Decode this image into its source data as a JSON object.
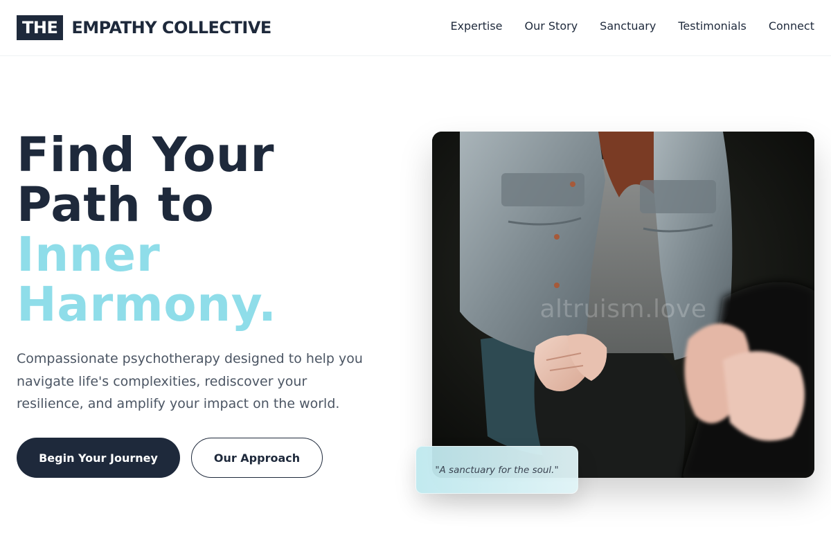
{
  "header": {
    "logo_mark": "THE",
    "logo_text": "EMPATHY COLLECTIVE",
    "nav": [
      {
        "label": "Expertise"
      },
      {
        "label": "Our Story"
      },
      {
        "label": "Sanctuary"
      },
      {
        "label": "Testimonials"
      },
      {
        "label": "Connect"
      }
    ]
  },
  "hero": {
    "title_line1": "Find Your",
    "title_line2": "Path to",
    "title_accent1": "Inner",
    "title_accent2": "Harmony.",
    "description": "Compassionate psychotherapy designed to help you navigate life's complexities, rediscover your resilience, and amplify your impact on the world.",
    "primary_button": "Begin Your Journey",
    "secondary_button": "Our Approach"
  },
  "image": {
    "watermark": "altruism.love",
    "quote": "\"A sanctuary for the soul.\""
  },
  "colors": {
    "primary": "#1e293b",
    "accent": "#8fdde9",
    "body_text": "#4b5563"
  }
}
